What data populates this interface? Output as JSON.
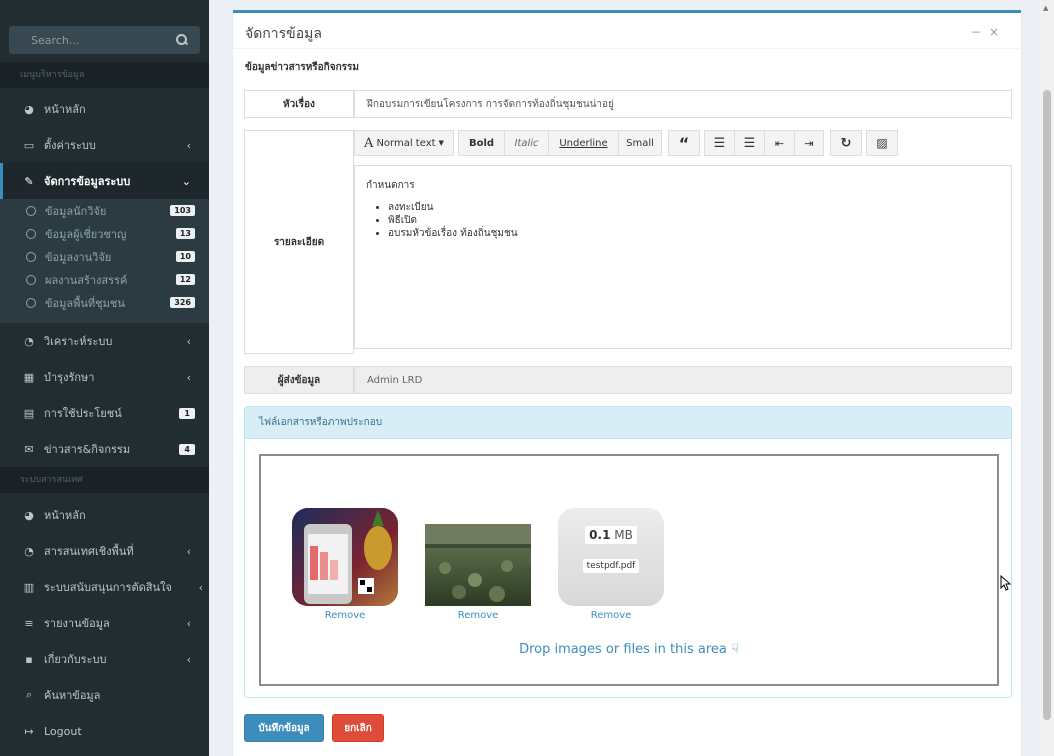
{
  "sidebar": {
    "search_placeholder": "Search...",
    "section1": "เมนูบริหารข้อมูล",
    "section2": "ระบบสารสนเทศ",
    "menu1": [
      {
        "label": "หน้าหลัก",
        "icon": "dashboard-icon"
      },
      {
        "label": "ตั้งค่าระบบ",
        "icon": "laptop-icon"
      },
      {
        "label": "จัดการข้อมูลระบบ",
        "icon": "edit-icon"
      }
    ],
    "sub": [
      {
        "label": "ข้อมูลนักวิจัย",
        "badge": "103"
      },
      {
        "label": "ข้อมูลผู้เชี่ยวชาญ",
        "badge": "13"
      },
      {
        "label": "ข้อมูลงานวิจัย",
        "badge": "10"
      },
      {
        "label": "ผลงานสร้างสรรค์",
        "badge": "12"
      },
      {
        "label": "ข้อมูลพื้นที่ชุมชน",
        "badge": "326"
      }
    ],
    "menu2": [
      {
        "label": "วิเคราะห์ระบบ",
        "icon": "pie-chart-icon"
      },
      {
        "label": "บำรุงรักษา",
        "icon": "table-icon"
      },
      {
        "label": "การใช้ประโยชน์",
        "icon": "calendar-icon",
        "badge": "1"
      },
      {
        "label": "ข่าวสาร&กิจกรรม",
        "icon": "envelope-icon",
        "badge": "4"
      }
    ],
    "menu3": [
      {
        "label": "หน้าหลัก",
        "icon": "dashboard-icon"
      },
      {
        "label": "สารสนเทศเชิงพื้นที่",
        "icon": "pie-chart-icon"
      },
      {
        "label": "ระบบสนับสนุนการตัดสินใจ",
        "icon": "bar-chart-icon"
      },
      {
        "label": "รายงานข้อมูล",
        "icon": "list-icon"
      },
      {
        "label": "เกี่ยวกับระบบ",
        "icon": "grid-icon"
      },
      {
        "label": "ค้นหาข้อมูล",
        "icon": "search-icon"
      },
      {
        "label": "Logout",
        "icon": "sign-out-icon"
      }
    ]
  },
  "box": {
    "title": "จัดการข้อมูล",
    "subtitle": "ข้อมูลข่าวสารหรือกิจกรรม"
  },
  "form": {
    "subject_label": "หัวเรื่อง",
    "subject_value": "ฝึกอบรมการเขียนโครงการ การจัดการท้องถิ่นชุมชนน่าอยู่",
    "detail_label": "รายละเอียด",
    "sender_label": "ผู้ส่งข้อมูล",
    "sender_value": "Admin LRD"
  },
  "toolbar": {
    "normal_text": "Normal text",
    "bold": "Bold",
    "italic": "Italic",
    "underline": "Underline",
    "small": "Small"
  },
  "editor": {
    "heading": "กำหนดการ",
    "items": [
      "ลงทะเบียน",
      "พิธีเปิด",
      "อบรมหัวข้อเรื่อง ท้องถิ่นชุมชน"
    ]
  },
  "attachments": {
    "panel_title": "ไฟล์เอกสารหรือภาพประกอบ",
    "remove_label": "Remove",
    "pdf_size": "0.1",
    "pdf_unit": "MB",
    "pdf_name": "testpdf.pdf",
    "drop_message": "Drop images or files in this area"
  },
  "buttons": {
    "save": "บันทึกข้อมูล",
    "cancel": "ยกเลิก"
  },
  "colors": {
    "sidebar_bg": "#222d32",
    "primary": "#3c8dbc",
    "danger": "#dd4b39"
  }
}
